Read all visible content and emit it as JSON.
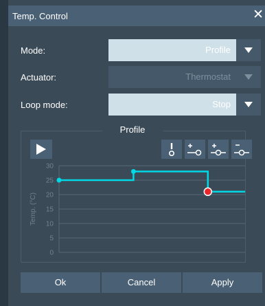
{
  "window": {
    "title": "Temp. Control"
  },
  "fields": {
    "mode": {
      "label": "Mode:",
      "value": "Profile"
    },
    "actuator": {
      "label": "Actuator:",
      "value": "Thermostat"
    },
    "loop_mode": {
      "label": "Loop mode:",
      "value": "Stop"
    }
  },
  "profile": {
    "title": "Profile",
    "toolbar_icons": [
      "play-icon",
      "alert-node-icon",
      "add-node-before-icon",
      "add-node-icon",
      "remove-node-icon"
    ],
    "chart_data": {
      "type": "line",
      "ylabel": "Temp. (°C)",
      "yticks": [
        "30",
        "25",
        "20",
        "15",
        "10",
        "5",
        "0"
      ],
      "ylim": [
        0,
        30
      ],
      "grid": true,
      "series_color": "#00d8e6",
      "point_colors": {
        "normal": "#00d8e6",
        "selected": "#e8262b"
      },
      "segments": [
        {
          "x0": 0,
          "x1": 1.0,
          "y": 25
        },
        {
          "x0": 1.0,
          "x1": 2.0,
          "y": 28
        },
        {
          "x0": 2.0,
          "x1": 2.5,
          "y": 21
        }
      ],
      "points": [
        {
          "x": 0,
          "y": 25,
          "selected": false
        },
        {
          "x": 1.0,
          "y": 28,
          "selected": false
        },
        {
          "x": 2.0,
          "y": 21,
          "selected": true
        }
      ],
      "xlim": [
        0,
        2.5
      ]
    }
  },
  "buttons": {
    "ok": "Ok",
    "cancel": "Cancel",
    "apply": "Apply"
  },
  "colors": {
    "accent": "#4a6175",
    "background": "#3b4a57"
  }
}
